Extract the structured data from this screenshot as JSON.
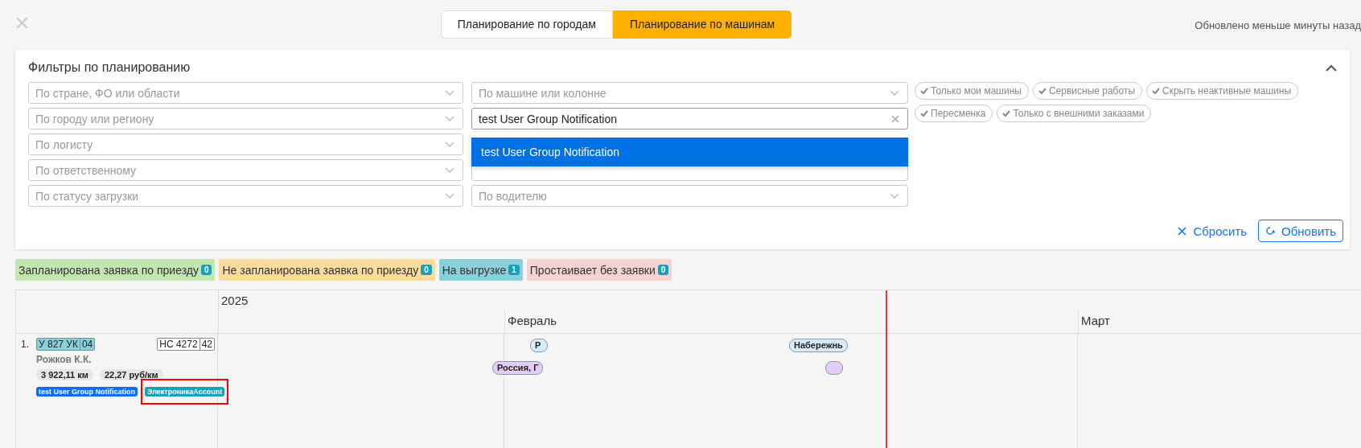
{
  "top_bar": {
    "close": "×",
    "tabs": [
      {
        "label": "Планирование по городам",
        "selected": false
      },
      {
        "label": "Планирование по машинам",
        "selected": true
      }
    ],
    "updated": "Обновлено меньше минуты назад"
  },
  "filters": {
    "title": "Фильтры по планированию",
    "expanded": true,
    "column_1": [
      {
        "placeholder": "По стране, ФО или области"
      },
      {
        "placeholder": "По городу или региону"
      },
      {
        "placeholder": "По логисту"
      },
      {
        "placeholder": "По ответственному"
      },
      {
        "placeholder": "По статусу загрузки"
      }
    ],
    "column_2": [
      {
        "kind": "select",
        "placeholder": "По машине или колонне"
      },
      {
        "kind": "select",
        "value": "test User Group Notification"
      },
      {
        "kind": "covered"
      },
      {
        "kind": "covered"
      },
      {
        "kind": "select",
        "placeholder": "По водителю"
      }
    ],
    "dropdown": {
      "options": [
        {
          "label": "test User Group Notification",
          "selected": true
        }
      ]
    },
    "toggles": [
      {
        "label": "Только мои машины",
        "checked": false
      },
      {
        "label": "Сервисные работы",
        "checked": false
      },
      {
        "label": "Скрыть неактивные машины",
        "checked": false
      },
      {
        "label": "Пересменка",
        "checked": false
      },
      {
        "label": "Только с внешними заказами",
        "checked": false
      }
    ],
    "reset": "Сбросить",
    "refresh": "Обновить"
  },
  "legend": [
    {
      "label": "Запланирована заявка по приезду",
      "count": "0",
      "color": "#c3e6b0"
    },
    {
      "label": "Не запланирована заявка по приезду",
      "count": "0",
      "color": "#fcdc9b"
    },
    {
      "label": "На выгрузке",
      "count": "1",
      "color": "#8bcfda"
    },
    {
      "label": "Простаивает без заявки",
      "count": "0",
      "color": "#f5d3d3"
    }
  ],
  "timeline": {
    "year": "2025",
    "months": [
      {
        "label": "Февраль"
      },
      {
        "label": "Март"
      }
    ],
    "vehicles": [
      {
        "number": "1.",
        "plate": "У 827 УК",
        "plate_region": "04",
        "trailer": "НС 4272",
        "trailer_region": "42",
        "driver": "Рожков К.К.",
        "stats": [
          "3 922,11 км",
          "22,27 руб/км"
        ],
        "tags": [
          {
            "label": "test User Group Notification",
            "color": "#0d6efd",
            "highlighted": false
          },
          {
            "label": "ЭлектроникаAccount",
            "color": "#17a2b8",
            "highlighted": true
          }
        ],
        "events": [
          {
            "label": "Р",
            "color": "#d6eaf8"
          },
          {
            "label": "Набережнь",
            "color": "#d6eaf8"
          },
          {
            "label": "Россия, Г",
            "color": "#e3cdf5"
          },
          {
            "color": "#e3cdf5"
          }
        ]
      }
    ]
  }
}
